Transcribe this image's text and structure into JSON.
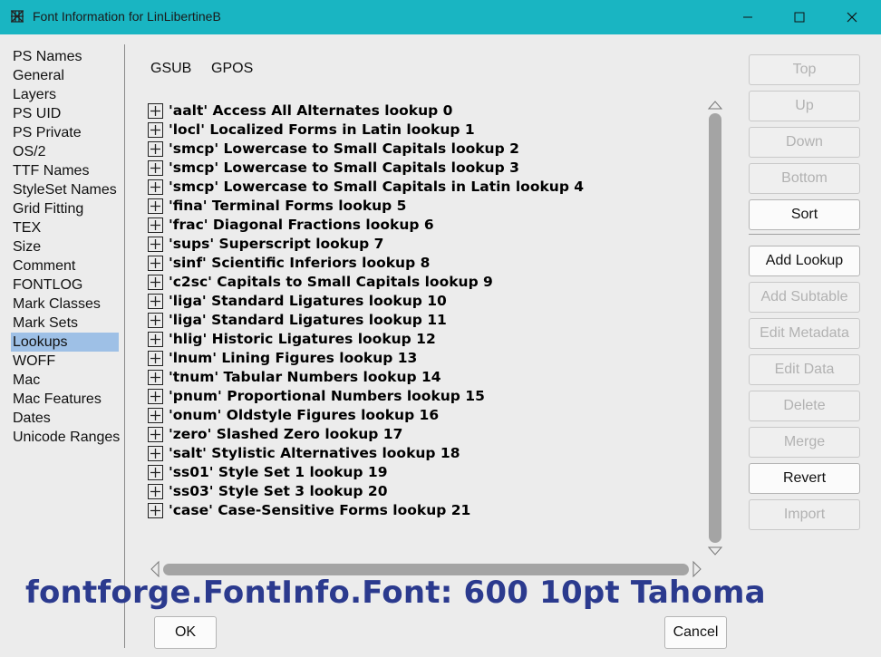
{
  "window": {
    "title": "Font Information for LinLibertineB",
    "controls": [
      "minimize-icon",
      "maximize-icon",
      "close-icon"
    ]
  },
  "sidebar": {
    "items": [
      {
        "label": "PS Names"
      },
      {
        "label": "General"
      },
      {
        "label": "Layers"
      },
      {
        "label": "PS UID"
      },
      {
        "label": "PS Private"
      },
      {
        "label": "OS/2"
      },
      {
        "label": "TTF Names"
      },
      {
        "label": "StyleSet Names"
      },
      {
        "label": "Grid Fitting"
      },
      {
        "label": "TEX"
      },
      {
        "label": "Size"
      },
      {
        "label": "Comment"
      },
      {
        "label": "FONTLOG"
      },
      {
        "label": "Mark Classes"
      },
      {
        "label": "Mark Sets"
      },
      {
        "label": "Lookups",
        "selected": true
      },
      {
        "label": "WOFF"
      },
      {
        "label": "Mac"
      },
      {
        "label": "Mac Features"
      },
      {
        "label": "Dates"
      },
      {
        "label": "Unicode Ranges"
      }
    ]
  },
  "tabs": [
    {
      "label": "GSUB",
      "active": true
    },
    {
      "label": "GPOS",
      "active": false
    }
  ],
  "lookups": [
    {
      "label": "'aalt' Access All Alternates lookup 0"
    },
    {
      "label": "'locl' Localized Forms in Latin lookup 1"
    },
    {
      "label": "'smcp' Lowercase to Small Capitals lookup 2"
    },
    {
      "label": "'smcp' Lowercase to Small Capitals lookup 3"
    },
    {
      "label": "'smcp' Lowercase to Small Capitals in Latin lookup 4"
    },
    {
      "label": "'fina' Terminal Forms lookup 5"
    },
    {
      "label": "'frac' Diagonal Fractions lookup 6"
    },
    {
      "label": "'sups' Superscript lookup 7"
    },
    {
      "label": "'sinf' Scientific Inferiors lookup 8"
    },
    {
      "label": "'c2sc' Capitals to Small Capitals lookup 9"
    },
    {
      "label": "'liga' Standard Ligatures lookup 10"
    },
    {
      "label": "'liga' Standard Ligatures lookup 11"
    },
    {
      "label": "'hlig' Historic Ligatures lookup 12"
    },
    {
      "label": "'lnum' Lining Figures lookup 13"
    },
    {
      "label": "'tnum' Tabular Numbers lookup 14"
    },
    {
      "label": "'pnum' Proportional Numbers lookup 15"
    },
    {
      "label": "'onum' Oldstyle Figures lookup 16"
    },
    {
      "label": "'zero' Slashed Zero lookup 17"
    },
    {
      "label": "'salt' Stylistic Alternatives lookup 18"
    },
    {
      "label": "'ss01' Style Set 1 lookup 19"
    },
    {
      "label": "'ss03' Style Set 3 lookup 20"
    },
    {
      "label": "'case' Case-Sensitive Forms lookup 21"
    }
  ],
  "buttons": {
    "top": {
      "label": "Top",
      "enabled": false
    },
    "up": {
      "label": "Up",
      "enabled": false
    },
    "down": {
      "label": "Down",
      "enabled": false
    },
    "bottom": {
      "label": "Bottom",
      "enabled": false
    },
    "sort": {
      "label": "Sort",
      "enabled": true
    },
    "add_lookup": {
      "label": "Add Lookup",
      "enabled": true
    },
    "add_subtable": {
      "label": "Add Subtable",
      "enabled": false
    },
    "edit_metadata": {
      "label": "Edit Metadata",
      "enabled": false
    },
    "edit_data": {
      "label": "Edit Data",
      "enabled": false
    },
    "delete": {
      "label": "Delete",
      "enabled": false
    },
    "merge": {
      "label": "Merge",
      "enabled": false
    },
    "revert": {
      "label": "Revert",
      "enabled": true
    },
    "import": {
      "label": "Import",
      "enabled": false
    }
  },
  "overlay_label": "fontforge.FontInfo.Font: 600 10pt Tahoma",
  "dialog": {
    "ok_label": "OK",
    "cancel_label": "Cancel"
  },
  "colors": {
    "titlebar": "#19b5c2",
    "selection": "#9ec0e6",
    "overlay_text": "#2b3a8e",
    "disabled_text": "#b2b2b2"
  }
}
